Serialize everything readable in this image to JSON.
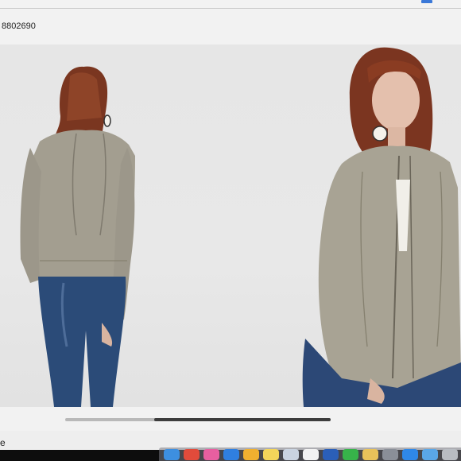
{
  "page": {
    "item_code": "8802690",
    "edge_text": "e"
  },
  "product_images": [
    {
      "name": "jacket-back-view"
    },
    {
      "name": "jacket-front-view"
    }
  ],
  "dock": {
    "icons": [
      {
        "name": "finder-icon",
        "color": "#3d8fe0"
      },
      {
        "name": "chrome-icon",
        "color": "#e24b3b"
      },
      {
        "name": "itunes-icon",
        "color": "#e85fa0"
      },
      {
        "name": "safari-icon",
        "color": "#2f7fe0"
      },
      {
        "name": "photos-icon",
        "color": "#f0b030"
      },
      {
        "name": "notes-icon",
        "color": "#f3d55a"
      },
      {
        "name": "preview-icon",
        "color": "#c9d3e0"
      },
      {
        "name": "reminders-icon",
        "color": "#f2f2f2"
      },
      {
        "name": "screen-share-icon",
        "color": "#2b5fb8"
      },
      {
        "name": "messages-icon",
        "color": "#37b34a"
      },
      {
        "name": "folder-icon",
        "color": "#e8c25a"
      },
      {
        "name": "system-preferences-icon",
        "color": "#8a8f98"
      },
      {
        "name": "appstore-icon",
        "color": "#2f88e8"
      },
      {
        "name": "downloads-folder-icon",
        "color": "#5aa7e8"
      },
      {
        "name": "trash-icon",
        "color": "#b8bcc2"
      }
    ]
  }
}
